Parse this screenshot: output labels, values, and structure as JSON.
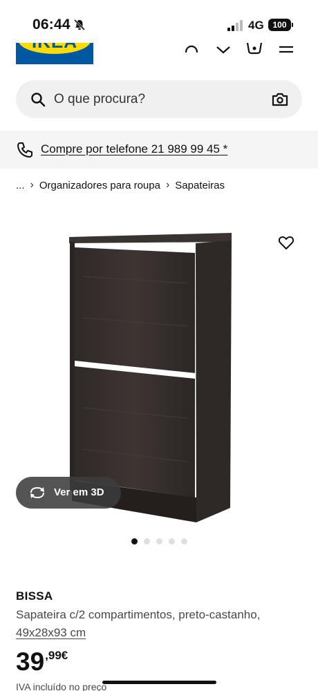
{
  "status_bar": {
    "time": "06:44",
    "network": "4G",
    "battery": "100"
  },
  "header": {
    "logo_text": "IKEA"
  },
  "search": {
    "placeholder": "O que procura?"
  },
  "phone_banner": {
    "text": "Compre por telefone 21 989 99 45 *"
  },
  "breadcrumb": {
    "ellipsis": "...",
    "items": [
      "Organizadores para roupa",
      "Sapateiras"
    ]
  },
  "media": {
    "view_3d_label": "Ver em 3D",
    "dot_count": 5,
    "active_dot": 0
  },
  "product": {
    "name": "BISSA",
    "description": "Sapateira c/2 compartimentos, preto-castanho,",
    "dimensions": "49x28x93 cm",
    "price_integer": "39",
    "price_decimal": ",99€",
    "vat_note": "IVA incluído no preço"
  },
  "colors": {
    "ikea_blue": "#0058a3",
    "ikea_yellow": "#ffdb00",
    "cabinet_brown": "#3b3431"
  }
}
